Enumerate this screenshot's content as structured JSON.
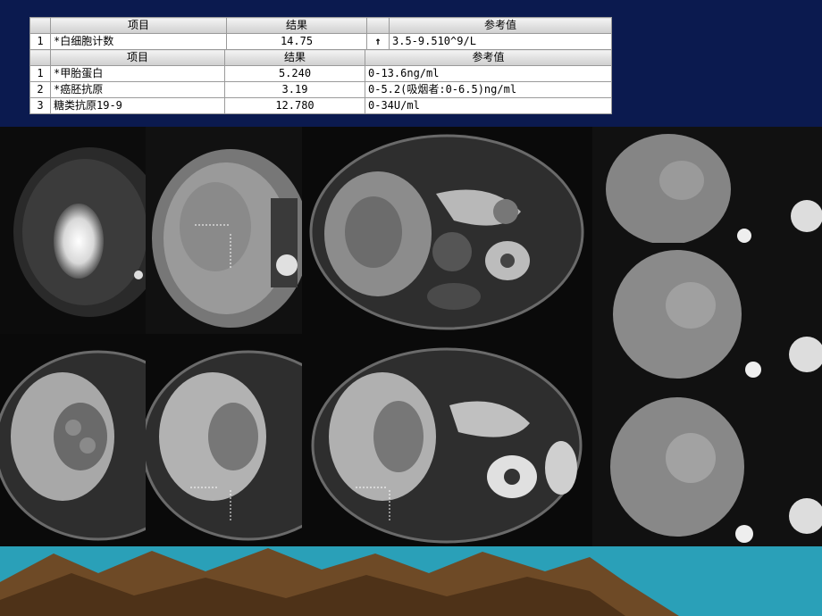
{
  "table_cbc": {
    "headers": [
      "项目",
      "结果",
      "参考值"
    ],
    "rows": [
      {
        "index": "1",
        "item": "*白细胞计数",
        "result": "14.75",
        "flag": "↑",
        "reference": "3.5-9.510^9/L"
      }
    ]
  },
  "table_markers": {
    "headers": [
      "项目",
      "结果",
      "参考值"
    ],
    "rows": [
      {
        "index": "1",
        "item": "*甲胎蛋白",
        "result": "5.240",
        "reference": "0-13.6ng/ml"
      },
      {
        "index": "2",
        "item": "*癌胚抗原",
        "result": "3.19",
        "reference": "0-5.2(吸烟者:0-6.5)ng/ml"
      },
      {
        "index": "3",
        "item": "糖类抗原19-9",
        "result": "12.780",
        "reference": "0-34U/ml"
      }
    ]
  },
  "colors": {
    "background": "#0b1a4f",
    "ground_teal": "#2aa0b8",
    "mountain_brown": "#6e4a26"
  },
  "images": [
    "mri-dwi-panel",
    "mri-adc-panel",
    "mri-t1-panel",
    "mri-arterial-panel",
    "mri-portal-panel",
    "mri-delayed-panel",
    "mri-coronal-top",
    "mri-coronal-middle",
    "mri-coronal-bottom"
  ]
}
